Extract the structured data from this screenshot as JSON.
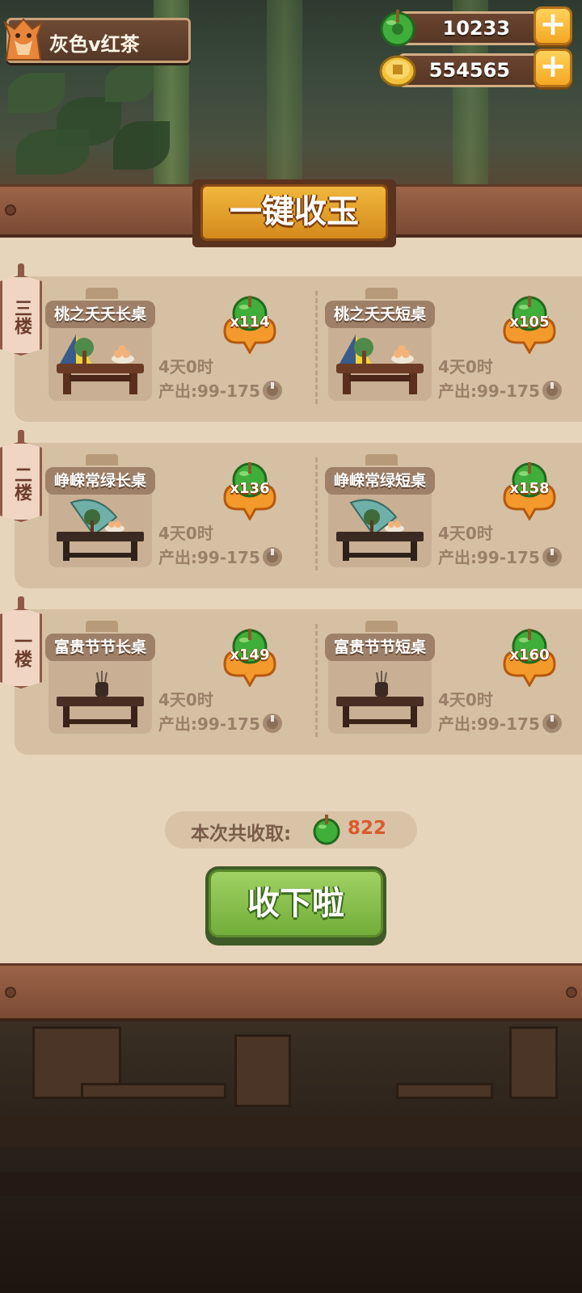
{
  "player": {
    "name": "灰色v红茶"
  },
  "resources": {
    "jade": {
      "value": "10233",
      "icon": "jade-icon"
    },
    "coins": {
      "value": "554565",
      "icon": "coin-icon"
    },
    "add_label": "+"
  },
  "panel": {
    "title": "一键收玉"
  },
  "floors": [
    {
      "label": "三楼",
      "items": [
        {
          "name": "桃之夭夭长桌",
          "jade": "x114",
          "time": "4天0时",
          "output": "产出:99-175"
        },
        {
          "name": "桃之夭夭短桌",
          "jade": "x105",
          "time": "4天0时",
          "output": "产出:99-175"
        }
      ]
    },
    {
      "label": "二楼",
      "items": [
        {
          "name": "峥嵘常绿长桌",
          "jade": "x136",
          "time": "4天0时",
          "output": "产出:99-175"
        },
        {
          "name": "峥嵘常绿短桌",
          "jade": "x158",
          "time": "4天0时",
          "output": "产出:99-175"
        }
      ]
    },
    {
      "label": "一楼",
      "items": [
        {
          "name": "富贵节节长桌",
          "jade": "x149",
          "time": "4天0时",
          "output": "产出:99-175"
        },
        {
          "name": "富贵节节短桌",
          "jade": "x160",
          "time": "4天0时",
          "output": "产出:99-175"
        }
      ]
    }
  ],
  "total": {
    "label": "本次共收取:",
    "value": "822"
  },
  "collect_button": {
    "label": "收下啦"
  },
  "colors": {
    "jade_green": "#3fae3a",
    "total_value": "#d95b2c",
    "button_green": "#86c04c",
    "title_gold": "#e9a52e"
  }
}
